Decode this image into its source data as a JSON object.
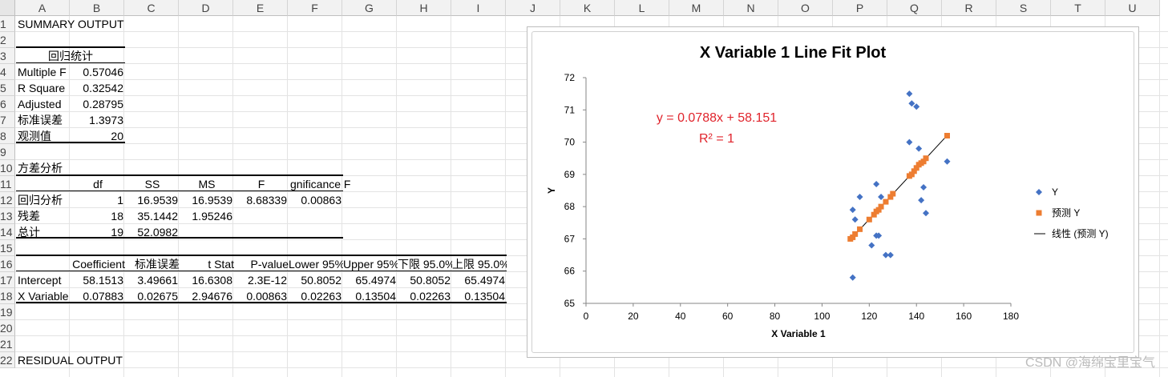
{
  "columns": [
    "A",
    "B",
    "C",
    "D",
    "E",
    "F",
    "G",
    "H",
    "I",
    "J",
    "K",
    "L",
    "M",
    "N",
    "O",
    "P",
    "Q",
    "R",
    "S",
    "T",
    "U"
  ],
  "rows": [
    "1",
    "2",
    "3",
    "4",
    "5",
    "6",
    "7",
    "8",
    "9",
    "10",
    "11",
    "12",
    "13",
    "14",
    "15",
    "16",
    "17",
    "18",
    "19",
    "20",
    "21",
    "22"
  ],
  "cells": {
    "summary_title": "SUMMARY OUTPUT",
    "reg_stats_header": "回归统计",
    "multiple_r_label": "Multiple F",
    "multiple_r": "0.57046",
    "r_square_label": "R Square",
    "r_square": "0.32542",
    "adjusted_label": "Adjusted",
    "adjusted": "0.28795",
    "std_err_label": "标准误差",
    "std_err": "1.3973",
    "obs_label": "观测值",
    "obs": "20",
    "anova_title": "方差分析",
    "anova_headers": [
      "df",
      "SS",
      "MS",
      "F",
      "gnificance F"
    ],
    "anova_rows": [
      {
        "label": "回归分析",
        "df": "1",
        "ss": "16.9539",
        "ms": "16.9539",
        "f": "8.68339",
        "sig": "0.00863"
      },
      {
        "label": "残差",
        "df": "18",
        "ss": "35.1442",
        "ms": "1.95246",
        "f": "",
        "sig": ""
      },
      {
        "label": "总计",
        "df": "19",
        "ss": "52.0982",
        "ms": "",
        "f": "",
        "sig": ""
      }
    ],
    "coef_headers": [
      "Coefficient",
      "标准误差",
      "t Stat",
      "P-value",
      "Lower 95%",
      "Upper 95%",
      "下限 95.0%",
      "上限 95.0%"
    ],
    "coef_rows": [
      {
        "label": "Intercept",
        "vals": [
          "58.1513",
          "3.49661",
          "16.6308",
          "2.3E-12",
          "50.8052",
          "65.4974",
          "50.8052",
          "65.4974"
        ]
      },
      {
        "label": "X Variable",
        "vals": [
          "0.07883",
          "0.02675",
          "2.94676",
          "0.00863",
          "0.02263",
          "0.13504",
          "0.02263",
          "0.13504"
        ]
      }
    ],
    "residual_title": "RESIDUAL OUTPUT"
  },
  "chart_data": {
    "type": "scatter",
    "title": "X Variable 1 Line Fit  Plot",
    "xlabel": "X Variable 1",
    "ylabel": "Y",
    "xlim": [
      0,
      180
    ],
    "ylim": [
      65,
      72
    ],
    "xticks": [
      "0",
      "20",
      "40",
      "60",
      "80",
      "100",
      "120",
      "140",
      "160",
      "180"
    ],
    "yticks": [
      "65",
      "66",
      "67",
      "68",
      "69",
      "70",
      "71",
      "72"
    ],
    "equation": "y = 0.0788x + 58.151",
    "r2": "R² = 1",
    "legend_placement": "right",
    "colors": {
      "y": "#4472c4",
      "pred": "#ed7d31",
      "trend": "#000000",
      "equation": "#e0242c"
    },
    "series": [
      {
        "name": "Y",
        "marker": "diamond",
        "points": [
          [
            113,
            67.9
          ],
          [
            114,
            67.6
          ],
          [
            116,
            68.3
          ],
          [
            113,
            65.8
          ],
          [
            121,
            66.8
          ],
          [
            123,
            67.1
          ],
          [
            124,
            67.1
          ],
          [
            123,
            68.7
          ],
          [
            125,
            68.3
          ],
          [
            127,
            66.5
          ],
          [
            129,
            66.5
          ],
          [
            137,
            71.5
          ],
          [
            138,
            71.2
          ],
          [
            140,
            71.1
          ],
          [
            137,
            70.0
          ],
          [
            141,
            69.8
          ],
          [
            143,
            68.6
          ],
          [
            142,
            68.2
          ],
          [
            144,
            67.8
          ],
          [
            153,
            69.4
          ]
        ]
      },
      {
        "name": "预测 Y",
        "marker": "square",
        "points": [
          [
            112,
            67.0
          ],
          [
            113,
            67.05
          ],
          [
            114,
            67.15
          ],
          [
            116,
            67.3
          ],
          [
            120,
            67.6
          ],
          [
            122,
            67.75
          ],
          [
            123,
            67.85
          ],
          [
            124,
            67.9
          ],
          [
            125,
            68.0
          ],
          [
            127,
            68.15
          ],
          [
            129,
            68.3
          ],
          [
            130,
            68.4
          ],
          [
            137,
            68.95
          ],
          [
            138,
            69.0
          ],
          [
            139,
            69.1
          ],
          [
            140,
            69.2
          ],
          [
            141,
            69.3
          ],
          [
            142,
            69.35
          ],
          [
            143,
            69.4
          ],
          [
            144,
            69.5
          ],
          [
            153,
            70.2
          ]
        ]
      }
    ],
    "trendline_name": "线性 (预测 Y)",
    "trendline": {
      "slope": 0.0788,
      "intercept": 58.151,
      "x_from": 112,
      "x_to": 153
    }
  },
  "watermark": "CSDN @海绵宝里宝气"
}
